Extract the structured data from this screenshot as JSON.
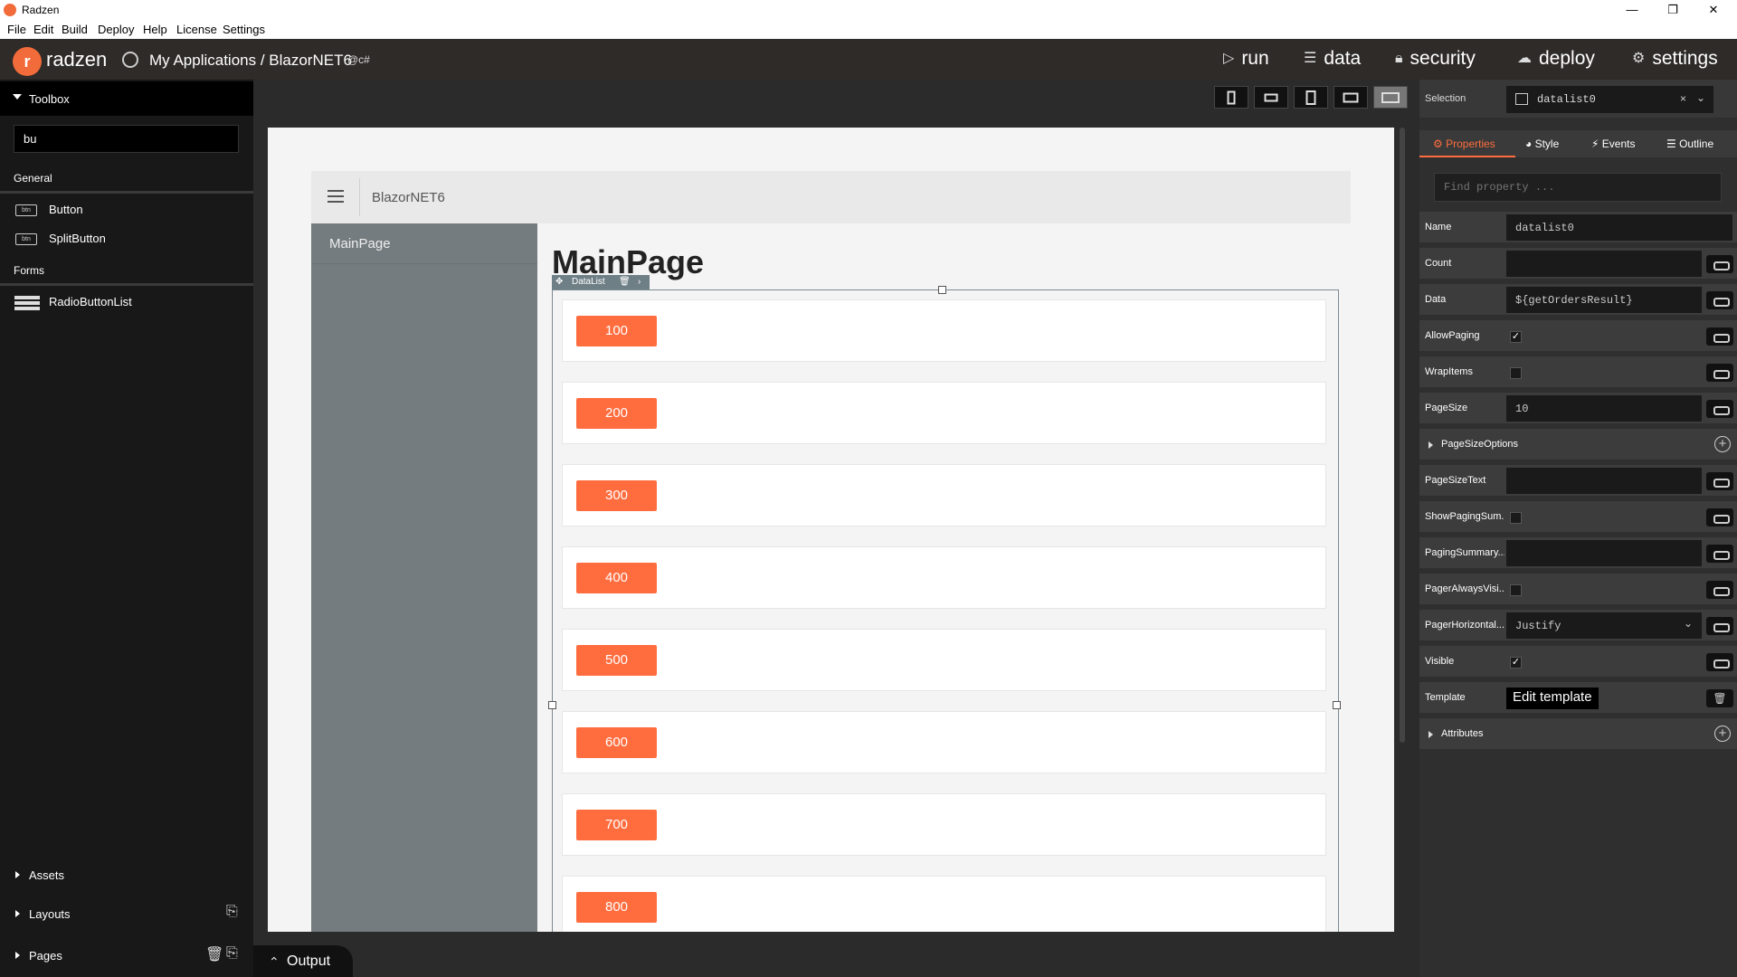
{
  "window": {
    "title": "Radzen",
    "minimize": "—",
    "maximize": "❐",
    "close": "✕"
  },
  "menu": [
    "File",
    "Edit",
    "Build",
    "Deploy",
    "Help",
    "License",
    "Settings"
  ],
  "topbar": {
    "logo_letter": "r",
    "logo_text": "radzen",
    "breadcrumb": "My Applications / BlazorNET6",
    "lang_badge": "@c#",
    "nav": [
      {
        "label": "run",
        "icon": "play-icon"
      },
      {
        "label": "data",
        "icon": "database-icon"
      },
      {
        "label": "security",
        "icon": "lock-icon"
      },
      {
        "label": "deploy",
        "icon": "cloud-upload-icon"
      },
      {
        "label": "settings",
        "icon": "gear-icon"
      }
    ]
  },
  "toolbox": {
    "header": "Toolbox",
    "search_value": "bu",
    "sections": {
      "general": "General",
      "forms": "Forms"
    },
    "items": {
      "button": {
        "label": "Button",
        "badge": "btn"
      },
      "splitbutton": {
        "label": "SplitButton",
        "badge": "btn"
      },
      "radiobuttonlist": {
        "label": "RadioButtonList"
      }
    },
    "accordion": {
      "assets": "Assets",
      "layouts": "Layouts",
      "pages": "Pages"
    }
  },
  "canvas": {
    "app_title": "BlazorNET6",
    "sidebar_item": "MainPage",
    "page_heading": "MainPage",
    "datalist_tag": "DataList",
    "rows": [
      "100",
      "200",
      "300",
      "400",
      "500",
      "600",
      "700",
      "800"
    ]
  },
  "output": {
    "label": "Output"
  },
  "properties": {
    "selection_label": "Selection",
    "selection_value": "datalist0",
    "tabs": [
      "Properties",
      "Style",
      "Events",
      "Outline"
    ],
    "find_placeholder": "Find property ...",
    "rows": {
      "name": {
        "label": "Name",
        "value": "datalist0"
      },
      "count": {
        "label": "Count",
        "value": ""
      },
      "data": {
        "label": "Data",
        "value": "${getOrdersResult}"
      },
      "allowpaging": {
        "label": "AllowPaging",
        "checked": true
      },
      "wrapitems": {
        "label": "WrapItems",
        "checked": false
      },
      "pagesize": {
        "label": "PageSize",
        "value": "10"
      },
      "pagesizeoptions": {
        "label": "PageSizeOptions"
      },
      "pagesizetext": {
        "label": "PageSizeText",
        "value": ""
      },
      "showpagingsummary": {
        "label": "ShowPagingSum...",
        "checked": false
      },
      "pagingsummary": {
        "label": "PagingSummary...",
        "value": ""
      },
      "pageralwaysvisible": {
        "label": "PagerAlwaysVisi...",
        "checked": false
      },
      "pagerhorizontal": {
        "label": "PagerHorizontal...",
        "value": "Justify"
      },
      "visible": {
        "label": "Visible",
        "checked": true
      },
      "template": {
        "label": "Template",
        "button": "Edit template"
      },
      "attributes": {
        "label": "Attributes"
      }
    }
  },
  "colors": {
    "accent": "#ff6d3f",
    "brand": "#f26b3a"
  }
}
